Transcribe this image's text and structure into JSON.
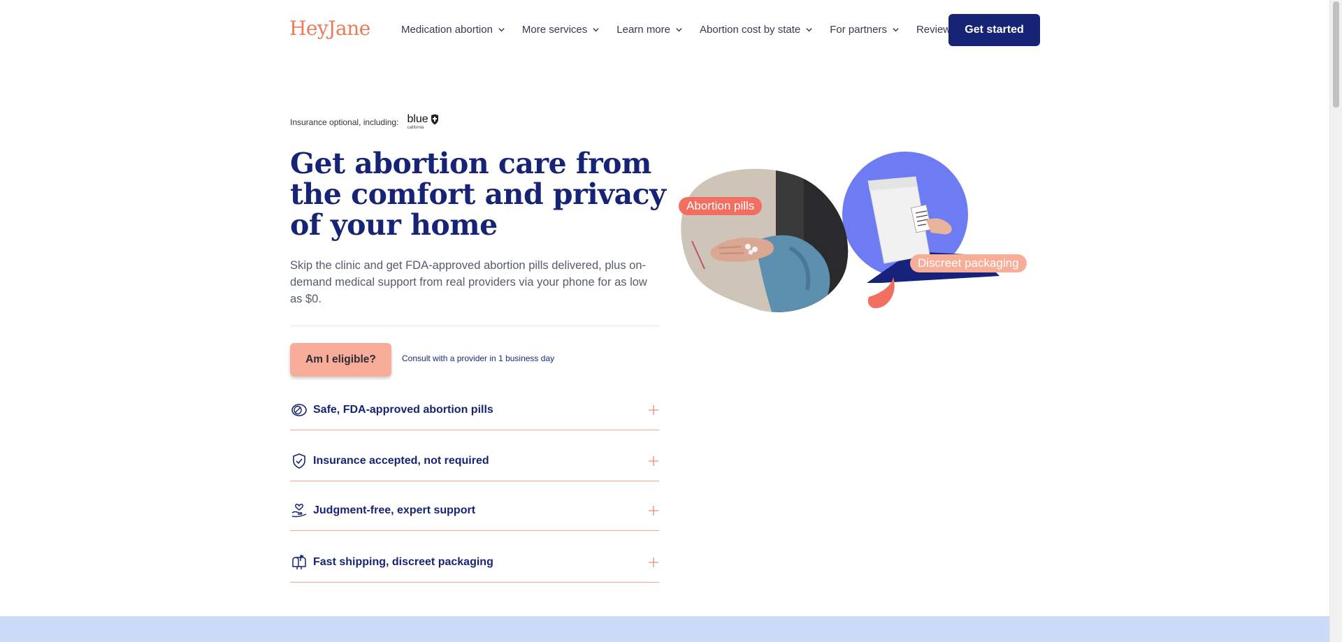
{
  "header": {
    "logo": "HeyJane",
    "nav": [
      {
        "label": "Medication abortion",
        "has_dropdown": true
      },
      {
        "label": "More services",
        "has_dropdown": true
      },
      {
        "label": "Learn more",
        "has_dropdown": true
      },
      {
        "label": "Abortion cost by state",
        "has_dropdown": true
      },
      {
        "label": "For partners",
        "has_dropdown": true
      },
      {
        "label": "Reviews",
        "has_dropdown": false
      }
    ],
    "cta_label": "Get started"
  },
  "hero": {
    "insurance_text": "Insurance optional, including:",
    "insurance_logo": "blue",
    "insurance_logo_sub": "california",
    "title": "Get abortion care from the comfort and privacy of your home",
    "subtitle": "Skip the clinic and get FDA-approved abortion pills delivered, plus on-demand medical support from real providers via your phone for as low as $0.",
    "eligible_button": "Am I eligible?",
    "consult_text": "Consult with a provider in 1 business day",
    "tags": {
      "pills": "Abortion pills",
      "packaging": "Discreet packaging"
    }
  },
  "features": [
    {
      "label": "Safe, FDA-approved abortion pills",
      "icon": "pill-icon"
    },
    {
      "label": "Insurance accepted, not required",
      "icon": "shield-check-icon"
    },
    {
      "label": "Judgment-free, expert support",
      "icon": "heart-hand-icon"
    },
    {
      "label": "Fast shipping, discreet packaging",
      "icon": "mailbox-icon"
    }
  ],
  "colors": {
    "brand_navy": "#172476",
    "brand_coral": "#ee7a57",
    "eligible_button": "#f7ad97",
    "tag": "#f16e60",
    "accent_purple": "#6d7cf2",
    "band": "#ccdcf8"
  }
}
